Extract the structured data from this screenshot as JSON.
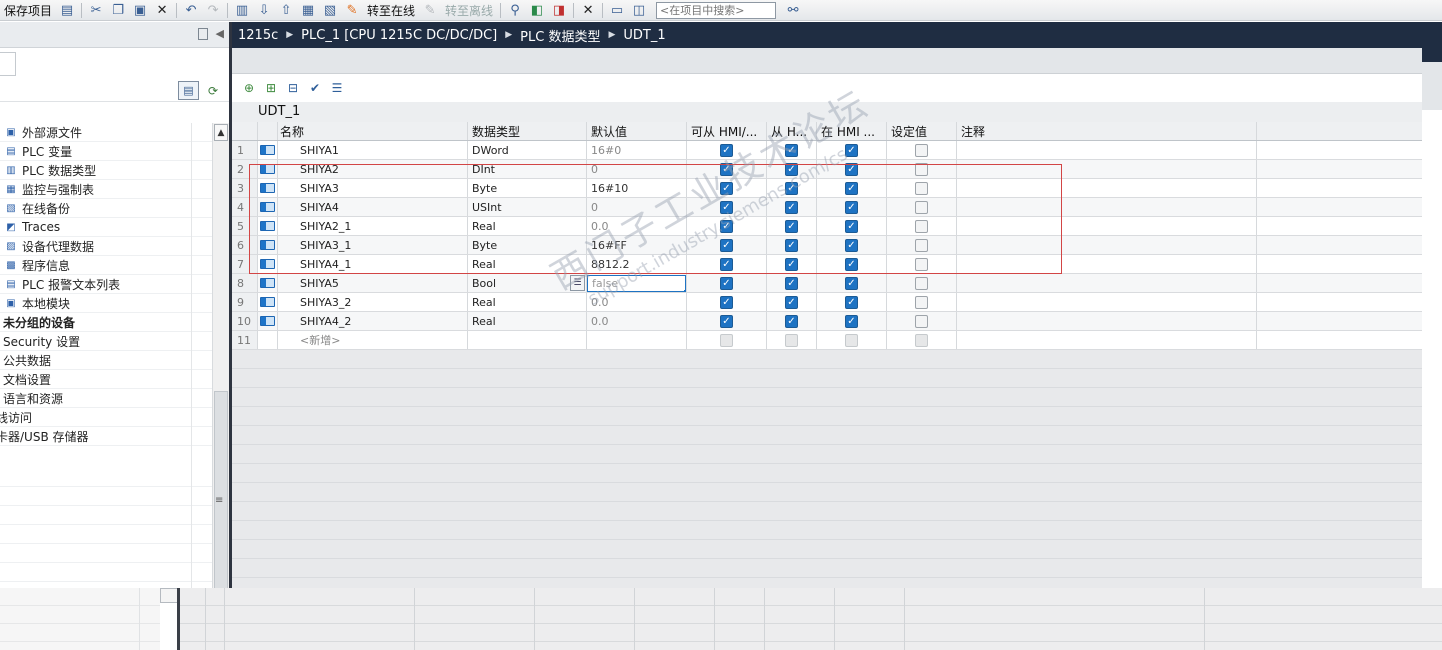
{
  "toolbar": {
    "save_project": "保存项目",
    "go_online": "转至在线",
    "go_offline": "转至离线",
    "search_placeholder": "<在项目中搜索>"
  },
  "left_tree": [
    {
      "label": "外部源文件",
      "icon": "folder-doc-icon",
      "style": "normal"
    },
    {
      "label": "PLC 变量",
      "icon": "plc-tags-icon",
      "style": "normal"
    },
    {
      "label": "PLC 数据类型",
      "icon": "data-types-icon",
      "style": "normal"
    },
    {
      "label": "监控与强制表",
      "icon": "watch-table-icon",
      "style": "normal"
    },
    {
      "label": "在线备份",
      "icon": "online-backup-icon",
      "style": "normal"
    },
    {
      "label": "Traces",
      "icon": "traces-icon",
      "style": "normal"
    },
    {
      "label": "设备代理数据",
      "icon": "proxy-data-icon",
      "style": "normal"
    },
    {
      "label": "程序信息",
      "icon": "program-info-icon",
      "style": "normal"
    },
    {
      "label": "PLC 报警文本列表",
      "icon": "alarm-text-icon",
      "style": "normal"
    },
    {
      "label": "本地模块",
      "icon": "local-modules-icon",
      "style": "normal"
    },
    {
      "label": "未分组的设备",
      "icon": "",
      "style": "bold"
    },
    {
      "label": "Security 设置",
      "icon": "",
      "style": "plain"
    },
    {
      "label": "公共数据",
      "icon": "",
      "style": "plain"
    },
    {
      "label": "文档设置",
      "icon": "",
      "style": "plain"
    },
    {
      "label": "语言和资源",
      "icon": "",
      "style": "plain"
    },
    {
      "label": "线访问",
      "icon": "",
      "style": "clip"
    },
    {
      "label": "卡器/USB 存储器",
      "icon": "",
      "style": "clip"
    }
  ],
  "breadcrumb": [
    "1215c",
    "PLC_1 [CPU 1215C DC/DC/DC]",
    "PLC 数据类型",
    "UDT_1"
  ],
  "editor": {
    "title": "UDT_1",
    "columns": {
      "name": "名称",
      "type": "数据类型",
      "default": "默认值",
      "hmi_access": "可从 HMI/...",
      "from_hmi": "从 H...",
      "in_hmi": "在 HMI ...",
      "setpoint": "设定值",
      "comment": "注释"
    },
    "rows": [
      {
        "num": "1",
        "name": "SHIYA1",
        "type": "DWord",
        "default": "16#0",
        "hmi1": true,
        "hmi2": true,
        "hmi3": true,
        "setpoint": false
      },
      {
        "num": "2",
        "name": "SHIYA2",
        "type": "DInt",
        "default": "0",
        "hmi1": true,
        "hmi2": true,
        "hmi3": true,
        "setpoint": false
      },
      {
        "num": "3",
        "name": "SHIYA3",
        "type": "Byte",
        "default": "16#10",
        "hmi1": true,
        "hmi2": true,
        "hmi3": true,
        "setpoint": false
      },
      {
        "num": "4",
        "name": "SHIYA4",
        "type": "USInt",
        "default": "0",
        "hmi1": true,
        "hmi2": true,
        "hmi3": true,
        "setpoint": false
      },
      {
        "num": "5",
        "name": "SHIYA2_1",
        "type": "Real",
        "default": "0.0",
        "hmi1": true,
        "hmi2": true,
        "hmi3": true,
        "setpoint": false
      },
      {
        "num": "6",
        "name": "SHIYA3_1",
        "type": "Byte",
        "default": "16#FF",
        "hmi1": true,
        "hmi2": true,
        "hmi3": true,
        "setpoint": false
      },
      {
        "num": "7",
        "name": "SHIYA4_1",
        "type": "Real",
        "default": "8812.2",
        "hmi1": true,
        "hmi2": true,
        "hmi3": true,
        "setpoint": false
      },
      {
        "num": "8",
        "name": "SHIYA5",
        "type": "Bool",
        "default": "false",
        "hmi1": true,
        "hmi2": true,
        "hmi3": true,
        "setpoint": false,
        "editing": true
      },
      {
        "num": "9",
        "name": "SHIYA3_2",
        "type": "Real",
        "default": "0.0",
        "hmi1": true,
        "hmi2": true,
        "hmi3": true,
        "setpoint": false
      },
      {
        "num": "10",
        "name": "SHIYA4_2",
        "type": "Real",
        "default": "0.0",
        "hmi1": true,
        "hmi2": true,
        "hmi3": true,
        "setpoint": false
      }
    ],
    "add_row": {
      "num": "11",
      "label": "<新增>"
    }
  },
  "watermark": {
    "line1": "西门子工业技术论坛",
    "line2": "support.industry.siemens.com/cs"
  },
  "colors": {
    "header_navy": "#1f2d42",
    "checkbox_blue": "#1e73c3",
    "highlight_red": "#d24545"
  }
}
